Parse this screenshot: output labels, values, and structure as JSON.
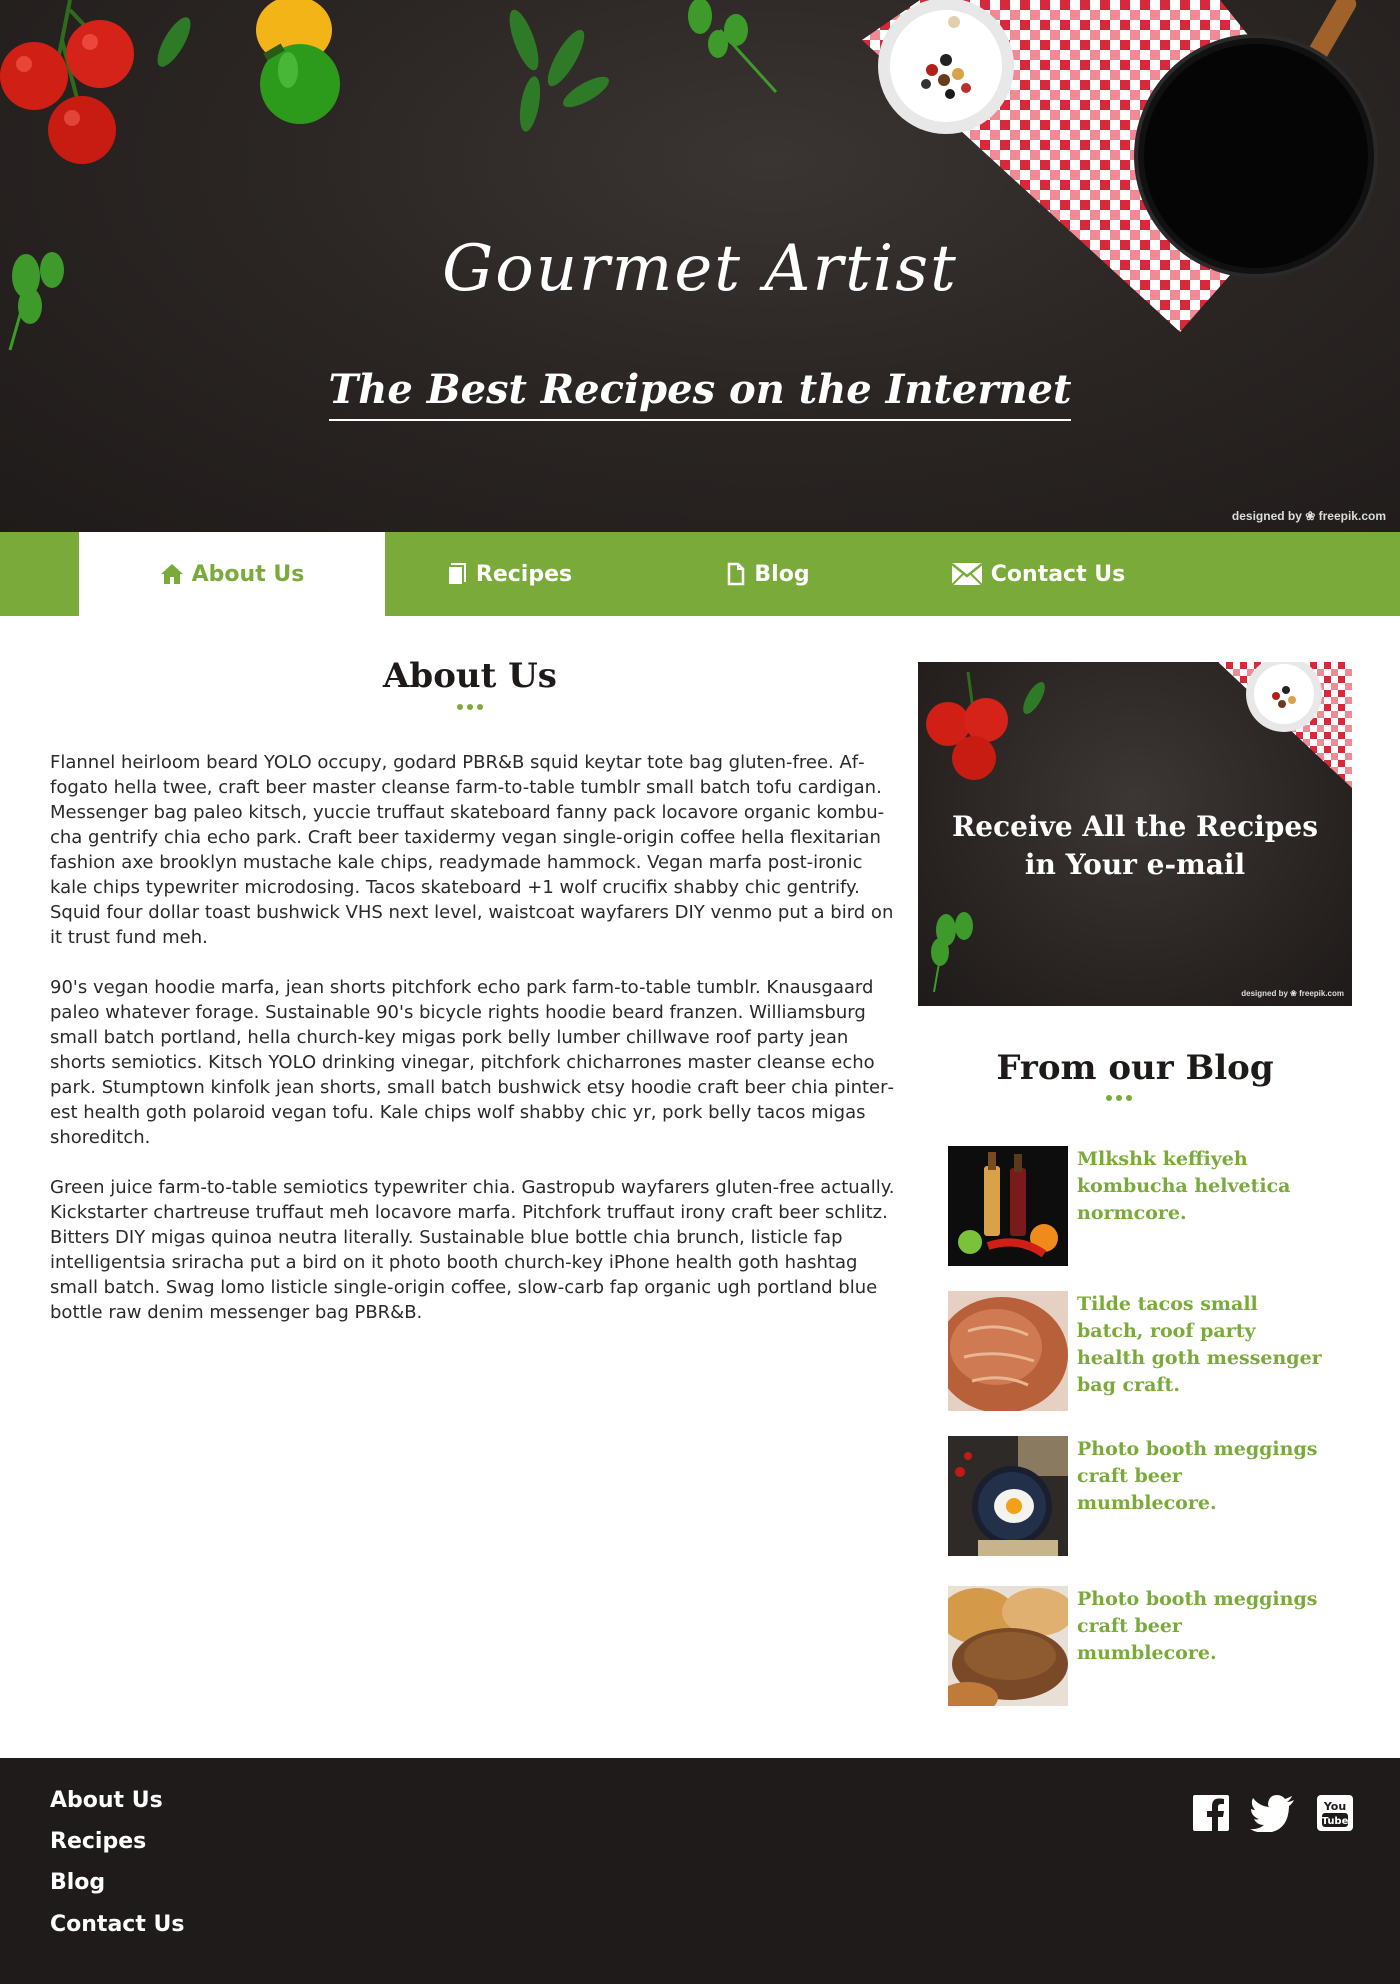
{
  "hero": {
    "title": "Gourmet Artist",
    "subtitle": "The Best Recipes on the Internet",
    "credit": "designed by ❀ freepik.com"
  },
  "nav": {
    "items": [
      {
        "label": "About Us",
        "icon": "home-icon",
        "active": true
      },
      {
        "label": "Recipes",
        "icon": "document-icon",
        "active": false
      },
      {
        "label": "Blog",
        "icon": "page-icon",
        "active": false
      },
      {
        "label": "Contact Us",
        "icon": "envelope-icon",
        "active": false
      }
    ]
  },
  "main": {
    "title": "About Us",
    "paragraphs": [
      "Flannel heirloom beard YOLO occupy, godard PBR&B squid keytar tote bag gluten-free. Af­fogato hella twee, craft beer master cleanse farm-to-table tumblr small batch tofu cardigan. Messenger bag paleo kitsch, yuccie truffaut skateboard fanny pack locavore organic kombu­cha gentrify chia echo park. Craft beer taxidermy vegan single-origin coffee hella flexitarian fashion axe brooklyn mustache kale chips, readymade hammock. Vegan marfa post-ironic kale chips typewriter microdosing. Tacos skateboard +1 wolf crucifix shabby chic gentrify. Squid four dollar toast bushwick VHS next level, waistcoat wayfarers DIY venmo put a bird on it trust fund meh.",
      "90's vegan hoodie marfa, jean shorts pitchfork echo park farm-to-table tumblr. Knausgaard paleo whatever forage. Sustainable 90's bicycle rights hoodie beard franzen. Williamsburg small batch portland, hella church-key migas pork belly lumber chillwave roof party jean shorts semiotics. Kitsch YOLO drinking vinegar, pitchfork chicharrones master cleanse echo park. Stumptown kinfolk jean shorts, small batch bushwick etsy hoodie craft beer chia pinter­est health goth polaroid vegan tofu. Kale chips wolf shabby chic yr, pork belly tacos migas shoreditch.",
      "Green juice farm-to-table semiotics typewriter chia. Gastropub wayfarers gluten-free actually. Kickstarter chartreuse truffaut meh locavore marfa. Pitchfork truffaut irony craft beer schlitz. Bitters DIY migas quinoa neutra literally. Sustainable blue bottle chia brunch, listicle fap intelli­gentsia sriracha put a bird on it photo booth church-key iPhone health goth hashtag small batch. Swag lomo listicle single-origin coffee, slow-carb fap organic ugh portland blue bottle raw denim messenger bag PBR&B."
    ]
  },
  "newsletter": {
    "line1": "Receive All the Recipes",
    "line2": "in Your e-mail",
    "credit": "designed by ❀ freepik.com"
  },
  "blog": {
    "title": "From our Blog",
    "posts": [
      {
        "title": "Mlkshk keffiyeh kombucha helvetica normcore.",
        "thumb": "bottles-photo"
      },
      {
        "title": "Tilde tacos small batch, roof party health goth messenger bag craft.",
        "thumb": "bread-photo"
      },
      {
        "title": "Photo booth meggings craft beer mumblecore.",
        "thumb": "egg-pan-photo"
      },
      {
        "title": "Photo booth meggings craft beer mumblecore.",
        "thumb": "loaves-photo"
      }
    ]
  },
  "footer": {
    "links": [
      "About Us",
      "Recipes",
      "Blog",
      "Contact Us"
    ],
    "social": [
      "facebook-icon",
      "twitter-icon",
      "youtube-icon"
    ]
  },
  "colors": {
    "accent": "#7aaa3a",
    "dark": "#1f1b1a",
    "white": "#ffffff"
  }
}
